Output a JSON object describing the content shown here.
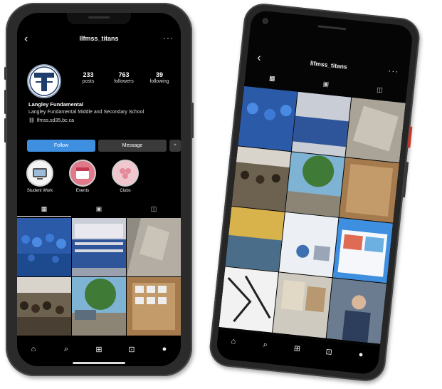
{
  "profile": {
    "username": "llfmss_titans",
    "stats": [
      {
        "value": "233",
        "label": "posts"
      },
      {
        "value": "763",
        "label": "followers"
      },
      {
        "value": "39",
        "label": "following"
      }
    ],
    "name": "Langley Fundamental",
    "description": "Langley Fundamental Middle and Secondary School",
    "link": "lfmss.sd35.bc.ca",
    "buttons": {
      "follow": "Follow",
      "message": "Message"
    },
    "highlights": [
      {
        "label": "Student Work"
      },
      {
        "label": "Events"
      },
      {
        "label": "Clubs"
      }
    ]
  },
  "icons": {
    "back": "‹",
    "more": "···",
    "grid": "▦",
    "reels": "▣",
    "tagged": "◫",
    "home": "⌂",
    "search": "⌕",
    "add": "⊞",
    "shop": "⊡",
    "link": "⛓",
    "add_user": "⁺"
  },
  "colors": {
    "accent": "#3e8fe0",
    "background": "#000000",
    "secondary_button": "#3a3a3a"
  }
}
